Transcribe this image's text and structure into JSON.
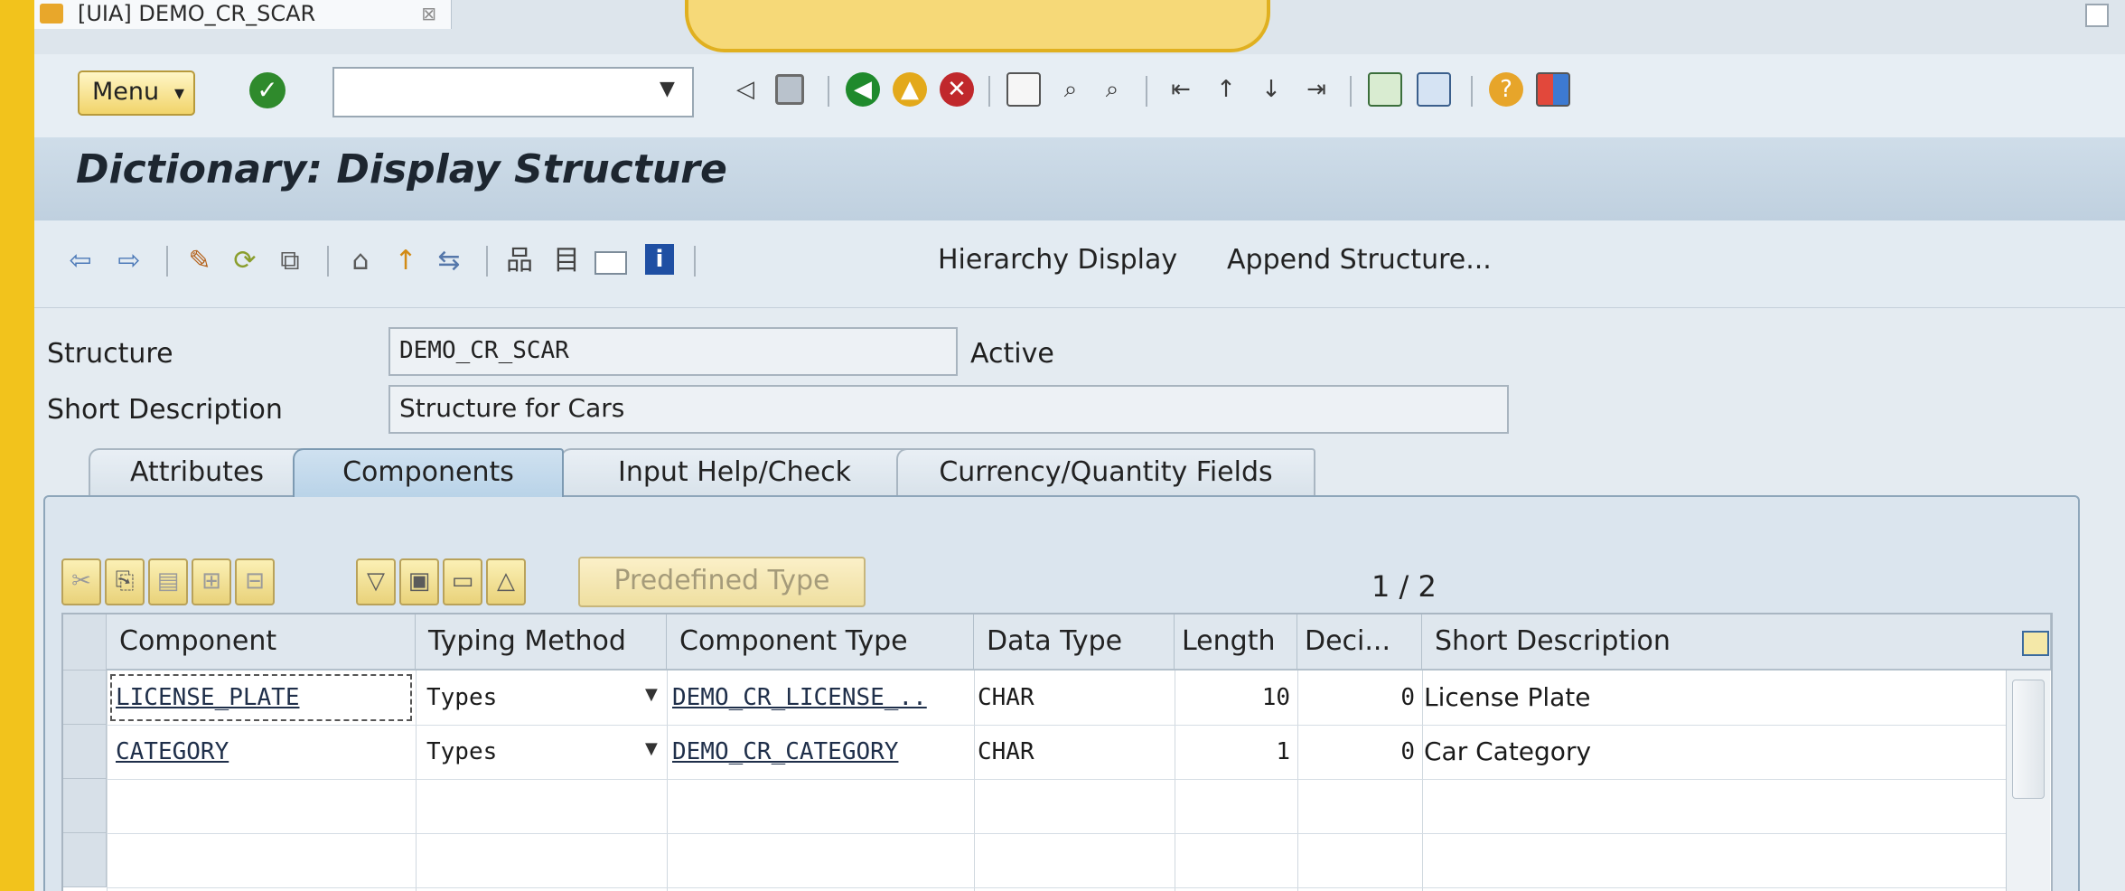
{
  "window": {
    "tab_title": "[UIA] DEMO_CR_SCAR",
    "tab_close": "⊠"
  },
  "system_toolbar": {
    "menu_label": "Menu",
    "command_field_value": ""
  },
  "title": "Dictionary: Display Structure",
  "app_toolbar": {
    "hierarchy_display": "Hierarchy Display",
    "append_structure": "Append Structure..."
  },
  "header": {
    "structure_label": "Structure",
    "structure_value": "DEMO_CR_SCAR",
    "status": "Active",
    "short_desc_label": "Short Description",
    "short_desc_value": "Structure for Cars"
  },
  "tabs": [
    {
      "label": "Attributes"
    },
    {
      "label": "Components"
    },
    {
      "label": "Input Help/Check"
    },
    {
      "label": "Currency/Quantity Fields"
    }
  ],
  "table_toolbar": {
    "predefined_type": "Predefined Type",
    "pager": "1 / 2"
  },
  "table": {
    "columns": [
      "Component",
      "Typing Method",
      "Component Type",
      "Data Type",
      "Length",
      "Deci...",
      "Short Description"
    ],
    "rows": [
      {
        "component": "LICENSE_PLATE",
        "typing": "Types",
        "ctype": "DEMO_CR_LICENSE_..",
        "dtype": "CHAR",
        "length": "10",
        "decimals": "0",
        "desc": "License Plate"
      },
      {
        "component": "CATEGORY",
        "typing": "Types",
        "ctype": "DEMO_CR_CATEGORY",
        "dtype": "CHAR",
        "length": "1",
        "decimals": "0",
        "desc": "Car Category"
      }
    ]
  }
}
